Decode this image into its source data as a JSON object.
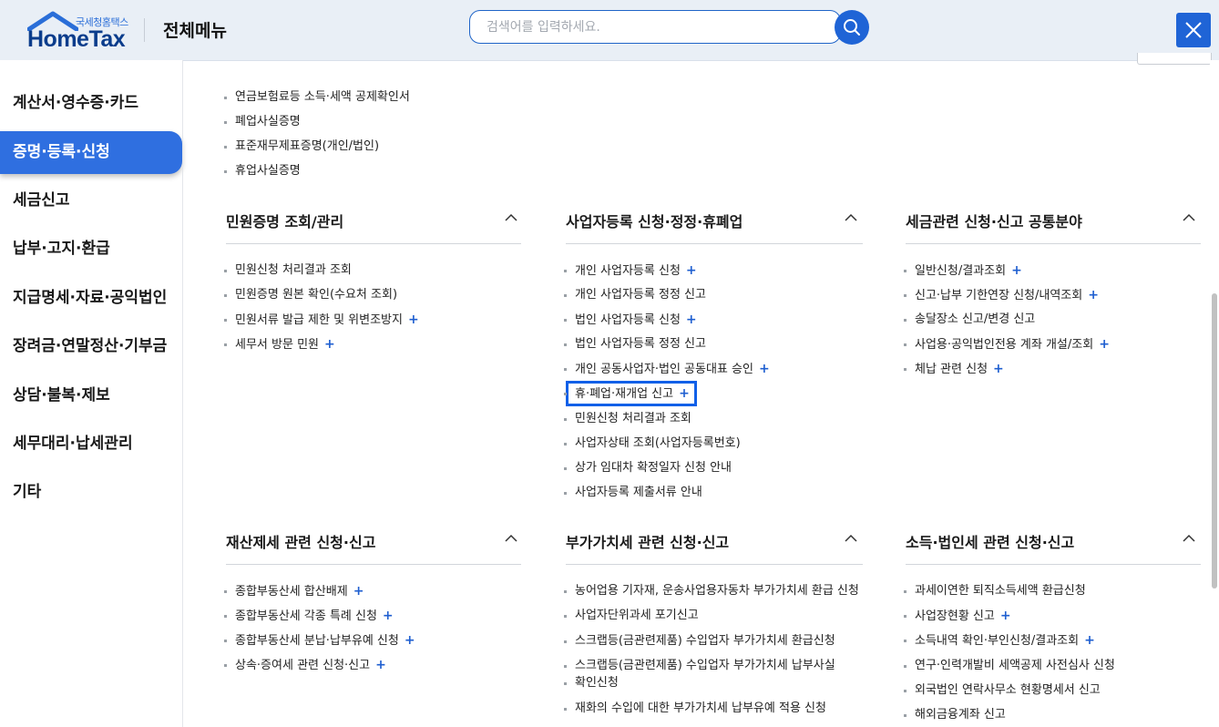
{
  "header": {
    "logo_small": "국세청홈택스",
    "logo_big": "HomeTax",
    "title": "전체메뉴",
    "search_placeholder": "검색어를 입력하세요."
  },
  "colors": {
    "accent": "#1f64d6",
    "active_menu": "#2f6fe0",
    "plus": "#1f5fd0",
    "highlight_border": "#1160e8"
  },
  "icons": {
    "search": "search-icon",
    "close": "close-icon",
    "chevron": "chevron-up-icon",
    "logo": "house-roof-icon"
  },
  "sidebar": {
    "items": [
      {
        "label": "계산서·영수증·카드"
      },
      {
        "label": "증명·등록·신청",
        "active": true
      },
      {
        "label": "세금신고"
      },
      {
        "label": "납부·고지·환급"
      },
      {
        "label": "지급명세·자료·공익법인"
      },
      {
        "label": "장려금·연말정산·기부금"
      },
      {
        "label": "상담·불복·제보"
      },
      {
        "label": "세무대리·납세관리"
      },
      {
        "label": "기타"
      }
    ]
  },
  "top_links": {
    "items": [
      {
        "label": "연금보험료등 소득·세액 공제확인서"
      },
      {
        "label": "폐업사실증명"
      },
      {
        "label": "표준재무제표증명(개인/법인)"
      },
      {
        "label": "휴업사실증명"
      }
    ]
  },
  "sections": [
    {
      "title": "민원증명 조회/관리",
      "links": [
        {
          "label": "민원신청 처리결과 조회",
          "plus": ""
        },
        {
          "label": "민원증명 원본 확인(수요처 조회)",
          "plus": ""
        },
        {
          "label": "민원서류 발급 제한 및 위변조방지",
          "plus": "+"
        },
        {
          "label": "세무서 방문 민원",
          "plus": "+"
        }
      ]
    },
    {
      "title": "사업자등록 신청·정정·휴폐업",
      "links": [
        {
          "label": "개인 사업자등록 신청",
          "plus": "+"
        },
        {
          "label": "개인 사업자등록 정정 신고",
          "plus": ""
        },
        {
          "label": "법인 사업자등록 신청",
          "plus": "+"
        },
        {
          "label": "법인 사업자등록 정정 신고",
          "plus": ""
        },
        {
          "label": "개인 공동사업자·법인 공동대표 승인",
          "plus": "+"
        },
        {
          "label": "휴·폐업·재개업 신고",
          "plus": "+",
          "highlighted": true
        },
        {
          "label": "민원신청 처리결과 조회",
          "plus": ""
        },
        {
          "label": "사업자상태 조회(사업자등록번호)",
          "plus": ""
        },
        {
          "label": "상가 임대차 확정일자 신청 안내",
          "plus": ""
        },
        {
          "label": "사업자등록 제출서류 안내",
          "plus": ""
        }
      ]
    },
    {
      "title": "세금관련 신청·신고 공통분야",
      "links": [
        {
          "label": "일반신청/결과조회",
          "plus": "+"
        },
        {
          "label": "신고·납부 기한연장 신청/내역조회",
          "plus": "+"
        },
        {
          "label": "송달장소 신고/변경 신고",
          "plus": ""
        },
        {
          "label": "사업용·공익법인전용 계좌 개설/조회",
          "plus": "+"
        },
        {
          "label": "체납 관련 신청",
          "plus": "+"
        }
      ]
    },
    {
      "title": "재산제세 관련 신청·신고",
      "links": [
        {
          "label": "종합부동산세 합산배제",
          "plus": "+"
        },
        {
          "label": "종합부동산세 각종 특례 신청",
          "plus": "+"
        },
        {
          "label": "종합부동산세 분납·납부유예 신청",
          "plus": "+"
        },
        {
          "label": "상속·증여세 관련 신청·신고",
          "plus": "+"
        }
      ]
    },
    {
      "title": "부가가치세 관련 신청·신고",
      "links": [
        {
          "label": "농어업용 기자재, 운송사업용자동차 부가가치세 환급 신청",
          "plus": ""
        },
        {
          "label": "사업자단위과세 포기신고",
          "plus": ""
        },
        {
          "label": "스크랩등(금관련제품) 수입업자 부가가치세 환급신청",
          "plus": ""
        },
        {
          "label": "스크랩등(금관련제품) 수입업자 부가가치세 납부사실",
          "label2": "확인신청",
          "plus": ""
        },
        {
          "label": "재화의 수입에 대한 부가가치세 납부유예 적용 신청",
          "plus": ""
        }
      ]
    },
    {
      "title": "소득·법인세 관련 신청·신고",
      "links": [
        {
          "label": "과세이연한 퇴직소득세액 환급신청",
          "plus": ""
        },
        {
          "label": "사업장현황 신고",
          "plus": "+"
        },
        {
          "label": "소득내역 확인·부인신청/결과조회",
          "plus": "+"
        },
        {
          "label": "연구·인력개발비 세액공제 사전심사 신청",
          "plus": ""
        },
        {
          "label": "외국법인 연락사무소 현황명세서 신고",
          "plus": ""
        },
        {
          "label": "해외금융계좌 신고",
          "plus": ""
        }
      ]
    }
  ]
}
